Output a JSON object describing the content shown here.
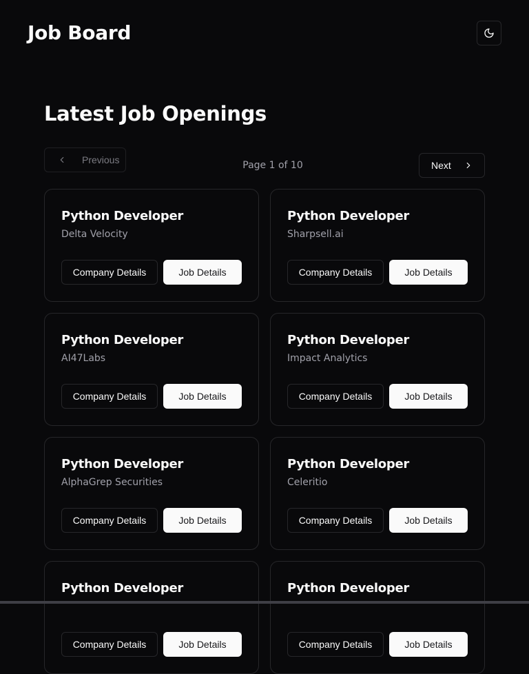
{
  "header": {
    "title": "Job Board",
    "theme_toggle_icon": "moon-icon"
  },
  "main": {
    "section_title": "Latest Job Openings",
    "pagination": {
      "previous_label": "Previous",
      "next_label": "Next",
      "page_info": "Page 1 of 10",
      "previous_disabled": true
    },
    "jobs": [
      {
        "title": "Python Developer",
        "company": "Delta Velocity",
        "company_btn": "Company Details",
        "job_btn": "Job Details"
      },
      {
        "title": "Python Developer",
        "company": "Sharpsell.ai",
        "company_btn": "Company Details",
        "job_btn": "Job Details"
      },
      {
        "title": "Python Developer",
        "company": "AI47Labs",
        "company_btn": "Company Details",
        "job_btn": "Job Details"
      },
      {
        "title": "Python Developer",
        "company": "Impact Analytics",
        "company_btn": "Company Details",
        "job_btn": "Job Details"
      },
      {
        "title": "Python Developer",
        "company": "AlphaGrep Securities",
        "company_btn": "Company Details",
        "job_btn": "Job Details"
      },
      {
        "title": "Python Developer",
        "company": "Celeritio",
        "company_btn": "Company Details",
        "job_btn": "Job Details"
      },
      {
        "title": "Python Developer",
        "company": "",
        "company_btn": "Company Details",
        "job_btn": "Job Details"
      },
      {
        "title": "Python Developer",
        "company": "",
        "company_btn": "Company Details",
        "job_btn": "Job Details"
      }
    ]
  },
  "colors": {
    "background": "#09090b",
    "border": "#27272a",
    "foreground": "#fafafa",
    "muted": "#a1a1aa"
  }
}
